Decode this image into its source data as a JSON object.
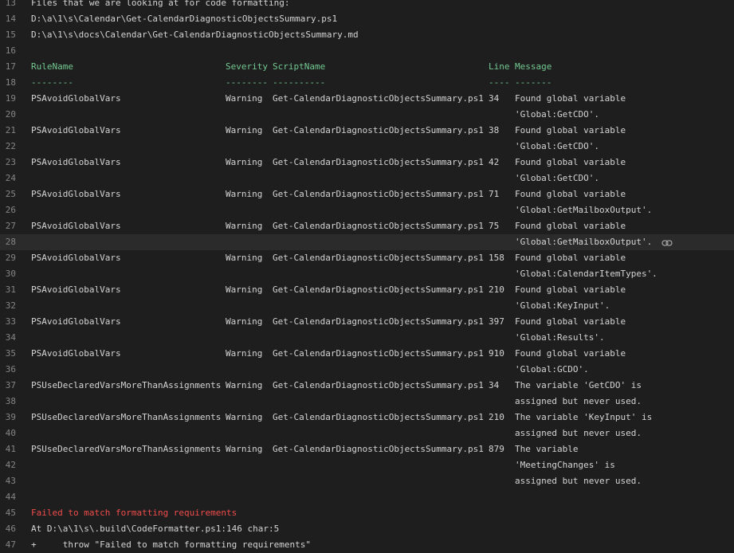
{
  "log": {
    "intro": [
      {
        "n": "13",
        "text": "Files that we are looking at for code formatting:"
      },
      {
        "n": "14",
        "text": "D:\\a\\1\\s\\Calendar\\Get-CalendarDiagnosticObjectsSummary.ps1"
      },
      {
        "n": "15",
        "text": "D:\\a\\1\\s\\docs\\Calendar\\Get-CalendarDiagnosticObjectsSummary.md"
      },
      {
        "n": "16",
        "text": ""
      }
    ],
    "table": {
      "header_line": "17",
      "underline_line": "18",
      "columns": [
        "RuleName",
        "Severity",
        "ScriptName",
        "Line",
        "Message"
      ],
      "underlines": [
        "--------",
        "--------",
        "----------",
        "----",
        "-------"
      ],
      "rows": [
        {
          "rule": "PSAvoidGlobalVars",
          "severity": "Warning",
          "script": "Get-CalendarDiagnosticObjectsSummary.ps1",
          "line": "34",
          "message": [
            "Found global variable",
            "'Global:GetCDO'."
          ],
          "nums": [
            "19",
            "20"
          ]
        },
        {
          "rule": "PSAvoidGlobalVars",
          "severity": "Warning",
          "script": "Get-CalendarDiagnosticObjectsSummary.ps1",
          "line": "38",
          "message": [
            "Found global variable",
            "'Global:GetCDO'."
          ],
          "nums": [
            "21",
            "22"
          ]
        },
        {
          "rule": "PSAvoidGlobalVars",
          "severity": "Warning",
          "script": "Get-CalendarDiagnosticObjectsSummary.ps1",
          "line": "42",
          "message": [
            "Found global variable",
            "'Global:GetCDO'."
          ],
          "nums": [
            "23",
            "24"
          ]
        },
        {
          "rule": "PSAvoidGlobalVars",
          "severity": "Warning",
          "script": "Get-CalendarDiagnosticObjectsSummary.ps1",
          "line": "71",
          "message": [
            "Found global variable",
            "'Global:GetMailboxOutput'."
          ],
          "nums": [
            "25",
            "26"
          ]
        },
        {
          "rule": "PSAvoidGlobalVars",
          "severity": "Warning",
          "script": "Get-CalendarDiagnosticObjectsSummary.ps1",
          "line": "75",
          "message": [
            "Found global variable",
            "'Global:GetMailboxOutput'."
          ],
          "nums": [
            "27",
            "28"
          ]
        },
        {
          "rule": "PSAvoidGlobalVars",
          "severity": "Warning",
          "script": "Get-CalendarDiagnosticObjectsSummary.ps1",
          "line": "158",
          "message": [
            "Found global variable",
            "'Global:CalendarItemTypes'."
          ],
          "nums": [
            "29",
            "30"
          ]
        },
        {
          "rule": "PSAvoidGlobalVars",
          "severity": "Warning",
          "script": "Get-CalendarDiagnosticObjectsSummary.ps1",
          "line": "210",
          "message": [
            "Found global variable",
            "'Global:KeyInput'."
          ],
          "nums": [
            "31",
            "32"
          ]
        },
        {
          "rule": "PSAvoidGlobalVars",
          "severity": "Warning",
          "script": "Get-CalendarDiagnosticObjectsSummary.ps1",
          "line": "397",
          "message": [
            "Found global variable",
            "'Global:Results'."
          ],
          "nums": [
            "33",
            "34"
          ]
        },
        {
          "rule": "PSAvoidGlobalVars",
          "severity": "Warning",
          "script": "Get-CalendarDiagnosticObjectsSummary.ps1",
          "line": "910",
          "message": [
            "Found global variable",
            "'Global:GCDO'."
          ],
          "nums": [
            "35",
            "36"
          ]
        },
        {
          "rule": "PSUseDeclaredVarsMoreThanAssignments",
          "severity": "Warning",
          "script": "Get-CalendarDiagnosticObjectsSummary.ps1",
          "line": "34",
          "message": [
            "The variable 'GetCDO' is",
            "assigned but never used."
          ],
          "nums": [
            "37",
            "38"
          ]
        },
        {
          "rule": "PSUseDeclaredVarsMoreThanAssignments",
          "severity": "Warning",
          "script": "Get-CalendarDiagnosticObjectsSummary.ps1",
          "line": "210",
          "message": [
            "The variable 'KeyInput' is",
            "assigned but never used."
          ],
          "nums": [
            "39",
            "40"
          ]
        },
        {
          "rule": "PSUseDeclaredVarsMoreThanAssignments",
          "severity": "Warning",
          "script": "Get-CalendarDiagnosticObjectsSummary.ps1",
          "line": "879",
          "message": [
            "The variable",
            "'MeetingChanges' is",
            "assigned but never used."
          ],
          "nums": [
            "41",
            "42",
            "43"
          ]
        }
      ]
    },
    "outro": [
      {
        "n": "44",
        "text": "",
        "kind": "plain"
      },
      {
        "n": "45",
        "text": "Failed to match formatting requirements",
        "kind": "error"
      },
      {
        "n": "46",
        "text": "At D:\\a\\1\\s\\.build\\CodeFormatter.ps1:146 char:5",
        "kind": "plain"
      },
      {
        "n": "47",
        "text": "+     throw \"Failed to match formatting requirements\"",
        "kind": "plain"
      }
    ],
    "highlighted_line": "28",
    "copy_icon": "copy-link-icon"
  }
}
